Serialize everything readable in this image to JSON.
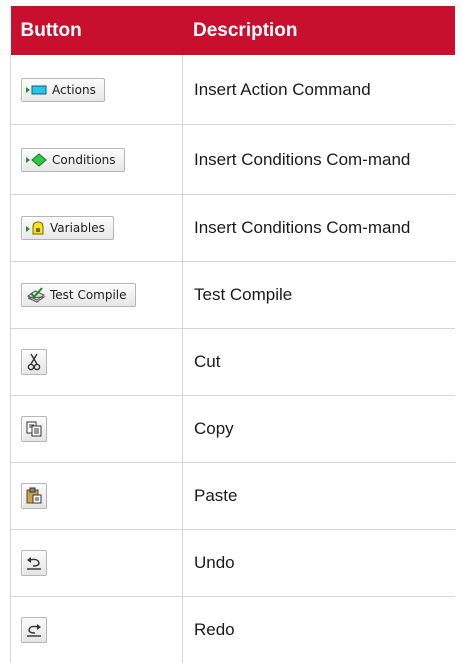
{
  "header": {
    "col_button": "Button",
    "col_description": "Description",
    "accent_color": "#c8102e"
  },
  "rows": [
    {
      "button_label": "Actions",
      "button_icon": "arrow-rectangle-icon",
      "description": "Insert Action Command"
    },
    {
      "button_label": "Conditions",
      "button_icon": "arrow-diamond-icon",
      "description": "Insert Conditions Com-mand"
    },
    {
      "button_label": "Variables",
      "button_icon": "arrow-bell-icon",
      "description": "Insert Conditions Com-mand"
    },
    {
      "button_label": "Test Compile",
      "button_icon": "test-compile-icon",
      "description": "Test Compile"
    },
    {
      "button_label": "",
      "button_icon": "scissors-icon",
      "description": "Cut"
    },
    {
      "button_label": "",
      "button_icon": "copy-icon",
      "description": "Copy"
    },
    {
      "button_label": "",
      "button_icon": "paste-icon",
      "description": "Paste"
    },
    {
      "button_label": "",
      "button_icon": "undo-icon",
      "description": "Undo"
    },
    {
      "button_label": "",
      "button_icon": "redo-icon",
      "description": "Redo"
    }
  ]
}
